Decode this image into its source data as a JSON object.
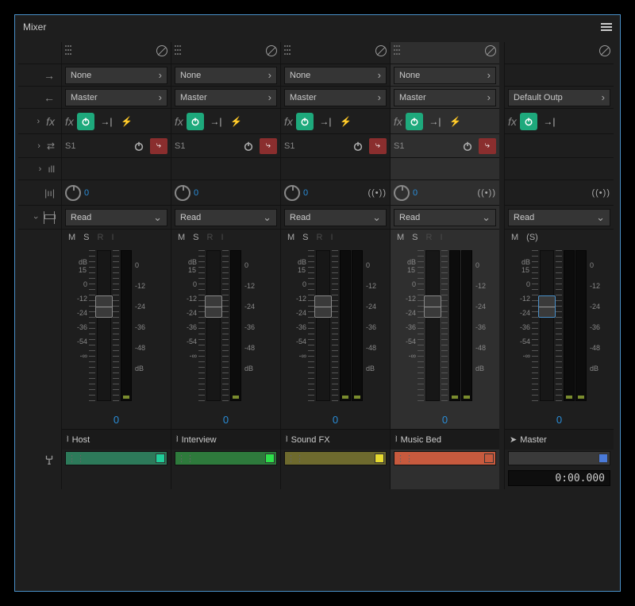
{
  "panel": {
    "title": "Mixer"
  },
  "labels": {
    "fx": "fx",
    "none": "None",
    "master": "Master",
    "read": "Read",
    "default_output": "Default Outp",
    "s1": "S1",
    "pan_zero": "0",
    "vol_zero": "0",
    "m": "M",
    "s": "S",
    "r": "R",
    "i": "I",
    "solo_paren": "(S)",
    "db": "dB",
    "db15": "15"
  },
  "db_scale_left": [
    "0",
    "-12",
    "-24",
    "-36",
    "-54",
    "-∞"
  ],
  "meter_scale": [
    "0",
    "-12",
    "-24",
    "-36",
    "-48",
    "dB"
  ],
  "tracks": [
    {
      "name": "Host",
      "color": "#2d7a5a",
      "swatch": "#1fcf9a",
      "selected": false,
      "stereo": false
    },
    {
      "name": "Interview",
      "color": "#2e7a3c",
      "swatch": "#2de04a",
      "selected": false,
      "stereo": false
    },
    {
      "name": "Sound FX",
      "color": "#6e6a2e",
      "swatch": "#e6da2f",
      "selected": false,
      "stereo": true
    },
    {
      "name": "Music Bed",
      "color": "#c75a3e",
      "swatch": "#c75a3e",
      "selected": true,
      "stereo": true
    }
  ],
  "master": {
    "name": "Master",
    "color": "#3a3a3a",
    "swatch": "#4a7ad8",
    "timecode": "0:00.000"
  }
}
